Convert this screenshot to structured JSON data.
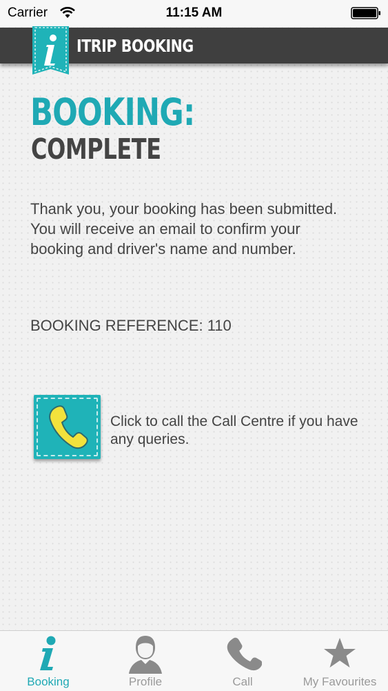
{
  "status_bar": {
    "carrier": "Carrier",
    "time": "11:15 AM"
  },
  "header": {
    "title": "ITRIP BOOKING",
    "logo_icon": "info-i-icon"
  },
  "content": {
    "heading_main": "BOOKING:",
    "heading_sub": "COMPLETE",
    "message": "Thank you, your booking has been submitted. You will receive an email to confirm your booking and driver's name and number.",
    "reference": "BOOKING REFERENCE: 110",
    "call_text": "Click to call the Call Centre if you have any queries.",
    "call_icon": "phone-icon"
  },
  "tabs": [
    {
      "label": "Booking",
      "icon": "info-i-icon",
      "active": true
    },
    {
      "label": "Profile",
      "icon": "person-icon",
      "active": false
    },
    {
      "label": "Call",
      "icon": "phone-icon",
      "active": false
    },
    {
      "label": "My Favourites",
      "icon": "star-icon",
      "active": false
    }
  ],
  "colors": {
    "accent": "#1fa9b4",
    "header_bg": "#3f3f3f",
    "text": "#444444",
    "call_yellow": "#f2e23c"
  }
}
